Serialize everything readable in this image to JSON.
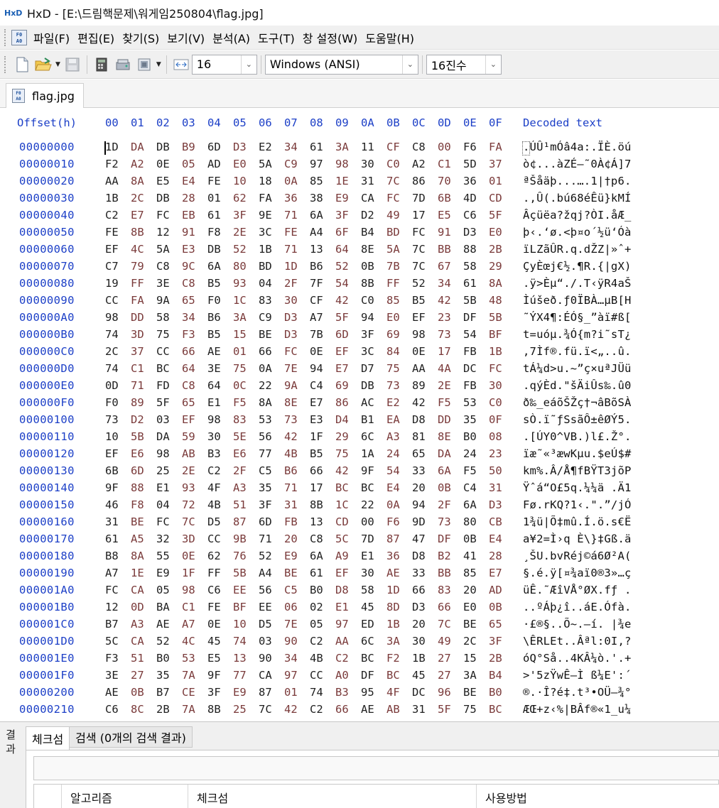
{
  "window": {
    "title": "HxD - [E:\\드림핵문제\\워게임250804\\flag.jpg]",
    "app_icon_text": "HxD"
  },
  "menu": {
    "items": [
      "파일(F)",
      "편집(E)",
      "찾기(S)",
      "보기(V)",
      "분석(A)",
      "도구(T)",
      "창 설정(W)",
      "도움말(H)"
    ]
  },
  "toolbar": {
    "bytes_per_row": "16",
    "charset": "Windows (ANSI)",
    "offset_base": "16진수"
  },
  "tab": {
    "file_name": "flag.jpg"
  },
  "hex_header": {
    "offset": "Offset(h)",
    "columns": [
      "00",
      "01",
      "02",
      "03",
      "04",
      "05",
      "06",
      "07",
      "08",
      "09",
      "0A",
      "0B",
      "0C",
      "0D",
      "0E",
      "0F"
    ],
    "decoded": "Decoded text"
  },
  "hex_rows": [
    {
      "offset": "00000000",
      "bytes": [
        "1D",
        "DA",
        "DB",
        "B9",
        "6D",
        "D3",
        "E2",
        "34",
        "61",
        "3A",
        "11",
        "CF",
        "C8",
        "00",
        "F6",
        "FA"
      ],
      "decoded": ".ÚÛ¹mÓâ4a:.ÏÈ.öú"
    },
    {
      "offset": "00000010",
      "bytes": [
        "F2",
        "A2",
        "0E",
        "05",
        "AD",
        "E0",
        "5A",
        "C9",
        "97",
        "98",
        "30",
        "C0",
        "A2",
        "C1",
        "5D",
        "37"
      ],
      "decoded": "ò¢...àZÉ—˜0À¢Á]7"
    },
    {
      "offset": "00000020",
      "bytes": [
        "AA",
        "8A",
        "E5",
        "E4",
        "FE",
        "10",
        "18",
        "0A",
        "85",
        "1E",
        "31",
        "7C",
        "86",
        "70",
        "36",
        "01"
      ],
      "decoded": "ªŠåäþ...….1|†p6."
    },
    {
      "offset": "00000030",
      "bytes": [
        "1B",
        "2C",
        "DB",
        "28",
        "01",
        "62",
        "FA",
        "36",
        "38",
        "E9",
        "CA",
        "FC",
        "7D",
        "6B",
        "4D",
        "CD"
      ],
      "decoded": ".,Û(.bú68éÊü}kMÍ"
    },
    {
      "offset": "00000040",
      "bytes": [
        "C2",
        "E7",
        "FC",
        "EB",
        "61",
        "3F",
        "9E",
        "71",
        "6A",
        "3F",
        "D2",
        "49",
        "17",
        "E5",
        "C6",
        "5F"
      ],
      "decoded": "Âçüëa?žqj?ÒI.åÆ_"
    },
    {
      "offset": "00000050",
      "bytes": [
        "FE",
        "8B",
        "12",
        "91",
        "F8",
        "2E",
        "3C",
        "FE",
        "A4",
        "6F",
        "B4",
        "BD",
        "FC",
        "91",
        "D3",
        "E0"
      ],
      "decoded": "þ‹.‘ø.<þ¤o´½ü‘Óà"
    },
    {
      "offset": "00000060",
      "bytes": [
        "EF",
        "4C",
        "5A",
        "E3",
        "DB",
        "52",
        "1B",
        "71",
        "13",
        "64",
        "8E",
        "5A",
        "7C",
        "BB",
        "88",
        "2B"
      ],
      "decoded": "ïLZãÛR.q.dŽZ|»ˆ+"
    },
    {
      "offset": "00000070",
      "bytes": [
        "C7",
        "79",
        "C8",
        "9C",
        "6A",
        "80",
        "BD",
        "1D",
        "B6",
        "52",
        "0B",
        "7B",
        "7C",
        "67",
        "58",
        "29"
      ],
      "decoded": "ÇyÈœj€½.¶R.{|gX)"
    },
    {
      "offset": "00000080",
      "bytes": [
        "19",
        "FF",
        "3E",
        "C8",
        "B5",
        "93",
        "04",
        "2F",
        "7F",
        "54",
        "8B",
        "FF",
        "52",
        "34",
        "61",
        "8A"
      ],
      "decoded": ".ÿ>Èµ“./.T‹ÿR4aŠ"
    },
    {
      "offset": "00000090",
      "bytes": [
        "CC",
        "FA",
        "9A",
        "65",
        "F0",
        "1C",
        "83",
        "30",
        "CF",
        "42",
        "C0",
        "85",
        "B5",
        "42",
        "5B",
        "48"
      ],
      "decoded": "Ìúšeð.ƒ0ÏBÀ…µB[H"
    },
    {
      "offset": "000000A0",
      "bytes": [
        "98",
        "DD",
        "58",
        "34",
        "B6",
        "3A",
        "C9",
        "D3",
        "A7",
        "5F",
        "94",
        "E0",
        "EF",
        "23",
        "DF",
        "5B"
      ],
      "decoded": "˜ÝX4¶:ÉÓ§_”àï#ß["
    },
    {
      "offset": "000000B0",
      "bytes": [
        "74",
        "3D",
        "75",
        "F3",
        "B5",
        "15",
        "BE",
        "D3",
        "7B",
        "6D",
        "3F",
        "69",
        "98",
        "73",
        "54",
        "BF"
      ],
      "decoded": "t=uóµ.¾Ó{m?i˜sT¿"
    },
    {
      "offset": "000000C0",
      "bytes": [
        "2C",
        "37",
        "CC",
        "66",
        "AE",
        "01",
        "66",
        "FC",
        "0E",
        "EF",
        "3C",
        "84",
        "0E",
        "17",
        "FB",
        "1B"
      ],
      "decoded": ",7Ìf®.fü.ï<„..û."
    },
    {
      "offset": "000000D0",
      "bytes": [
        "74",
        "C1",
        "BC",
        "64",
        "3E",
        "75",
        "0A",
        "7E",
        "94",
        "E7",
        "D7",
        "75",
        "AA",
        "4A",
        "DC",
        "FC"
      ],
      "decoded": "tÁ¼d>u.~”ç×uªJÜü"
    },
    {
      "offset": "000000E0",
      "bytes": [
        "0D",
        "71",
        "FD",
        "C8",
        "64",
        "0C",
        "22",
        "9A",
        "C4",
        "69",
        "DB",
        "73",
        "89",
        "2E",
        "FB",
        "30"
      ],
      "decoded": ".qýÈd.\"šÄiÛs‰.û0"
    },
    {
      "offset": "000000F0",
      "bytes": [
        "F0",
        "89",
        "5F",
        "65",
        "E1",
        "F5",
        "8A",
        "8E",
        "E7",
        "86",
        "AC",
        "E2",
        "42",
        "F5",
        "53",
        "C0"
      ],
      "decoded": "ð‰_eáõŠŽç†¬âBõSÀ"
    },
    {
      "offset": "00000100",
      "bytes": [
        "73",
        "D2",
        "03",
        "EF",
        "98",
        "83",
        "53",
        "73",
        "E3",
        "D4",
        "B1",
        "EA",
        "D8",
        "DD",
        "35",
        "0F"
      ],
      "decoded": "sÒ.ï˜ƒSsãÔ±êØÝ5."
    },
    {
      "offset": "00000110",
      "bytes": [
        "10",
        "5B",
        "DA",
        "59",
        "30",
        "5E",
        "56",
        "42",
        "1F",
        "29",
        "6C",
        "A3",
        "81",
        "8E",
        "B0",
        "08"
      ],
      "decoded": ".[ÚY0^VB.)l£.Ž°."
    },
    {
      "offset": "00000120",
      "bytes": [
        "EF",
        "E6",
        "98",
        "AB",
        "B3",
        "E6",
        "77",
        "4B",
        "B5",
        "75",
        "1A",
        "24",
        "65",
        "DA",
        "24",
        "23"
      ],
      "decoded": "ïæ˜«³æwKµu.$eÚ$#"
    },
    {
      "offset": "00000130",
      "bytes": [
        "6B",
        "6D",
        "25",
        "2E",
        "C2",
        "2F",
        "C5",
        "B6",
        "66",
        "42",
        "9F",
        "54",
        "33",
        "6A",
        "F5",
        "50"
      ],
      "decoded": "km%.Â/Å¶fBŸT3jõP"
    },
    {
      "offset": "00000140",
      "bytes": [
        "9F",
        "88",
        "E1",
        "93",
        "4F",
        "A3",
        "35",
        "71",
        "17",
        "BC",
        "BC",
        "E4",
        "20",
        "0B",
        "C4",
        "31"
      ],
      "decoded": "Ÿˆá“O£5q.¼¼ä .Ä1"
    },
    {
      "offset": "00000150",
      "bytes": [
        "46",
        "F8",
        "04",
        "72",
        "4B",
        "51",
        "3F",
        "31",
        "8B",
        "1C",
        "22",
        "0A",
        "94",
        "2F",
        "6A",
        "D3"
      ],
      "decoded": "Fø.rKQ?1‹.\".”/jÓ"
    },
    {
      "offset": "00000160",
      "bytes": [
        "31",
        "BE",
        "FC",
        "7C",
        "D5",
        "87",
        "6D",
        "FB",
        "13",
        "CD",
        "00",
        "F6",
        "9D",
        "73",
        "80",
        "CB"
      ],
      "decoded": "1¾ü|Õ‡mû.Í.ö.s€Ë"
    },
    {
      "offset": "00000170",
      "bytes": [
        "61",
        "A5",
        "32",
        "3D",
        "CC",
        "9B",
        "71",
        "20",
        "C8",
        "5C",
        "7D",
        "87",
        "47",
        "DF",
        "0B",
        "E4"
      ],
      "decoded": "a¥2=Ì›q È\\}‡Gß.ä"
    },
    {
      "offset": "00000180",
      "bytes": [
        "B8",
        "8A",
        "55",
        "0E",
        "62",
        "76",
        "52",
        "E9",
        "6A",
        "A9",
        "E1",
        "36",
        "D8",
        "B2",
        "41",
        "28"
      ],
      "decoded": "¸ŠU.bvRéj©á6Ø²A("
    },
    {
      "offset": "00000190",
      "bytes": [
        "A7",
        "1E",
        "E9",
        "1F",
        "FF",
        "5B",
        "A4",
        "BE",
        "61",
        "EF",
        "30",
        "AE",
        "33",
        "BB",
        "85",
        "E7"
      ],
      "decoded": "§.é.ÿ[¤¾aï0®3»…ç"
    },
    {
      "offset": "000001A0",
      "bytes": [
        "FC",
        "CA",
        "05",
        "98",
        "C6",
        "EE",
        "56",
        "C5",
        "B0",
        "D8",
        "58",
        "1D",
        "66",
        "83",
        "20",
        "AD"
      ],
      "decoded": "üÊ.˜ÆîVÅ°ØX.fƒ ."
    },
    {
      "offset": "000001B0",
      "bytes": [
        "12",
        "0D",
        "BA",
        "C1",
        "FE",
        "BF",
        "EE",
        "06",
        "02",
        "E1",
        "45",
        "8D",
        "D3",
        "66",
        "E0",
        "0B"
      ],
      "decoded": "..ºÁþ¿î..áE.Ófà."
    },
    {
      "offset": "000001C0",
      "bytes": [
        "B7",
        "A3",
        "AE",
        "A7",
        "0E",
        "10",
        "D5",
        "7E",
        "05",
        "97",
        "ED",
        "1B",
        "20",
        "7C",
        "BE",
        "65"
      ],
      "decoded": "·£®§..Õ~.—í. |¾e"
    },
    {
      "offset": "000001D0",
      "bytes": [
        "5C",
        "CA",
        "52",
        "4C",
        "45",
        "74",
        "03",
        "90",
        "C2",
        "AA",
        "6C",
        "3A",
        "30",
        "49",
        "2C",
        "3F"
      ],
      "decoded": "\\ÊRLEt..Âªl:0I,?"
    },
    {
      "offset": "000001E0",
      "bytes": [
        "F3",
        "51",
        "B0",
        "53",
        "E5",
        "13",
        "90",
        "34",
        "4B",
        "C2",
        "BC",
        "F2",
        "1B",
        "27",
        "15",
        "2B"
      ],
      "decoded": "óQ°Så..4KÂ¼ò.'.+"
    },
    {
      "offset": "000001F0",
      "bytes": [
        "3E",
        "27",
        "35",
        "7A",
        "9F",
        "77",
        "CA",
        "97",
        "CC",
        "A0",
        "DF",
        "BC",
        "45",
        "27",
        "3A",
        "B4"
      ],
      "decoded": ">'5zŸwÊ—Ì ß¼E':´"
    },
    {
      "offset": "00000200",
      "bytes": [
        "AE",
        "0B",
        "B7",
        "CE",
        "3F",
        "E9",
        "87",
        "01",
        "74",
        "B3",
        "95",
        "4F",
        "DC",
        "96",
        "BE",
        "B0"
      ],
      "decoded": "®.·Î?é‡.t³•OÜ–¾°"
    },
    {
      "offset": "00000210",
      "bytes": [
        "C6",
        "8C",
        "2B",
        "7A",
        "8B",
        "25",
        "7C",
        "42",
        "C2",
        "66",
        "AE",
        "AB",
        "31",
        "5F",
        "75",
        "BC"
      ],
      "decoded": "ÆŒ+z‹%|BÂf®«1_u¼"
    }
  ],
  "bottom_panel": {
    "side_label": "결과",
    "tabs": [
      "체크섬",
      "검색 (0개의 검색 결과)"
    ],
    "table_headers": [
      "알고리즘",
      "체크섬",
      "사용방법"
    ]
  }
}
